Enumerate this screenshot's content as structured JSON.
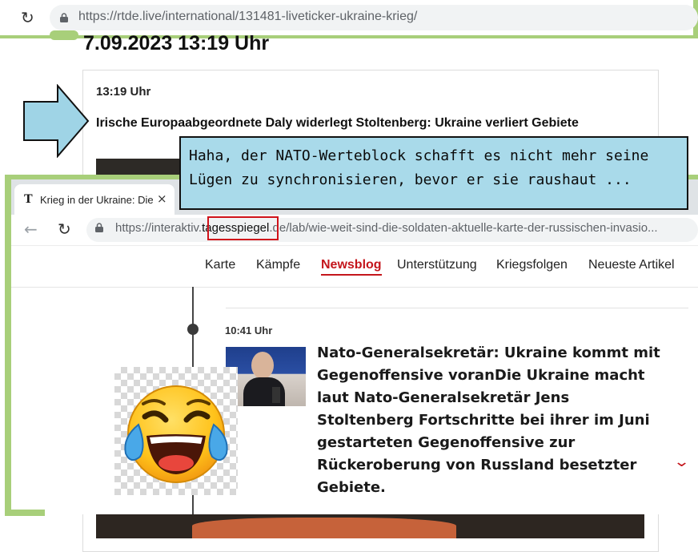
{
  "back_window": {
    "url": "https://rtde.live/international/131481-liveticker-ukraine-krieg/",
    "date_heading": "7.09.2023 13:19 Uhr",
    "entry_time": "13:19 Uhr",
    "entry_title": "Irische Europaabgeordnete Daly widerlegt Stoltenberg: Ukraine verliert Gebiete"
  },
  "speech": {
    "line1": "Haha, der NATO-Werteblock schafft es nicht mehr seine",
    "line2": "Lügen zu synchronisieren, bevor er sie raushaut ..."
  },
  "front_window": {
    "tab_icon": "T",
    "tab_title": "Krieg in der Ukraine: Die",
    "tab_close": "×",
    "url_prefix": "https://interaktiv.",
    "url_highlight": "tagesspiegel",
    "url_suffix": ".de/lab/wie-weit-sind-die-soldaten-aktuelle-karte-der-russischen-invasio...",
    "nav": [
      "Karte",
      "Kämpfe",
      "Newsblog",
      "Unterstützung",
      "Kriegsfolgen",
      "Neueste Artikel"
    ],
    "active_nav": "Newsblog",
    "entry_time": "10:41 Uhr",
    "article_text": "Nato-Generalsekretär: Ukraine kommt mit Gegenoffensive voranDie Ukraine macht laut Nato-Generalsekretär Jens Stoltenberg Fortschritte bei ihrer im Juni gestarteten Gegenoffensive zur Rückeroberung von Russland besetzter Gebiete."
  },
  "icons": {
    "reload": "reload-icon",
    "back": "back-arrow-icon",
    "lock": "lock-icon",
    "chevron": "chevron-down-icon",
    "emoji": "laughing-crying-emoji",
    "arrow": "blue-arrow-icon"
  },
  "colors": {
    "accent_red": "#c4161c",
    "speech_bg": "#a9daea",
    "arrow_fill": "#9fd4e6",
    "window_frame": "#a8cf7a",
    "highlight_box": "#d0121a"
  }
}
